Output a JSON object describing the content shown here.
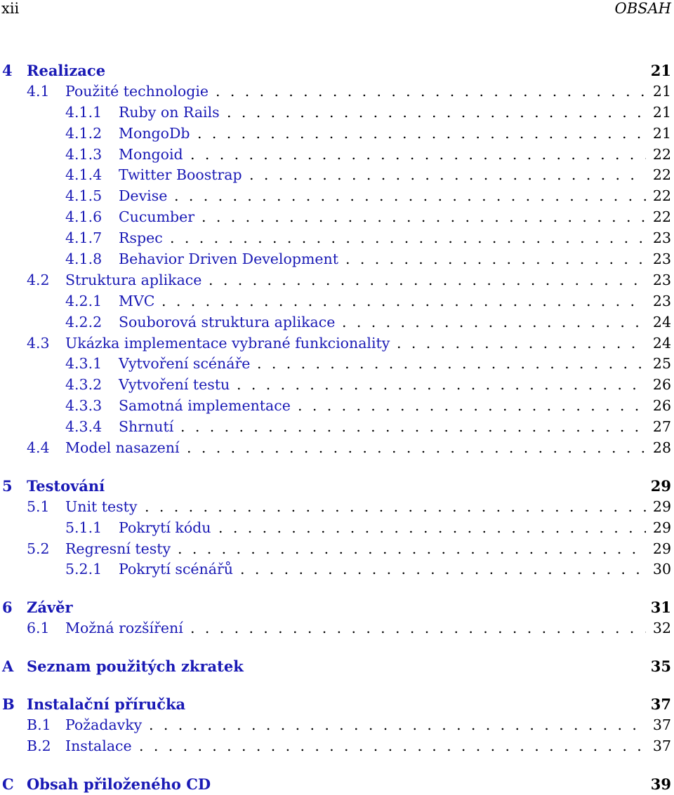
{
  "header": {
    "page_number": "xii",
    "title": "OBSAH"
  },
  "toc": [
    {
      "level": "chapter",
      "num": "4",
      "title": "Realizace",
      "page": "21",
      "gap": false
    },
    {
      "level": "section",
      "num": "4.1",
      "title": "Použité technologie",
      "page": "21"
    },
    {
      "level": "subsection",
      "num": "4.1.1",
      "title": "Ruby on Rails",
      "page": "21"
    },
    {
      "level": "subsection",
      "num": "4.1.2",
      "title": "MongoDb",
      "page": "21"
    },
    {
      "level": "subsection",
      "num": "4.1.3",
      "title": "Mongoid",
      "page": "22"
    },
    {
      "level": "subsection",
      "num": "4.1.4",
      "title": "Twitter Boostrap",
      "page": "22"
    },
    {
      "level": "subsection",
      "num": "4.1.5",
      "title": "Devise",
      "page": "22"
    },
    {
      "level": "subsection",
      "num": "4.1.6",
      "title": "Cucumber",
      "page": "22"
    },
    {
      "level": "subsection",
      "num": "4.1.7",
      "title": "Rspec",
      "page": "23"
    },
    {
      "level": "subsection",
      "num": "4.1.8",
      "title": "Behavior Driven Development",
      "page": "23"
    },
    {
      "level": "section",
      "num": "4.2",
      "title": "Struktura aplikace",
      "page": "23"
    },
    {
      "level": "subsection",
      "num": "4.2.1",
      "title": "MVC",
      "page": "23"
    },
    {
      "level": "subsection",
      "num": "4.2.2",
      "title": "Souborová struktura aplikace",
      "page": "24"
    },
    {
      "level": "section",
      "num": "4.3",
      "title": "Ukázka implementace vybrané funkcionality",
      "page": "24"
    },
    {
      "level": "subsection",
      "num": "4.3.1",
      "title": "Vytvoření scénáře",
      "page": "25"
    },
    {
      "level": "subsection",
      "num": "4.3.2",
      "title": "Vytvoření testu",
      "page": "26"
    },
    {
      "level": "subsection",
      "num": "4.3.3",
      "title": "Samotná implementace",
      "page": "26"
    },
    {
      "level": "subsection",
      "num": "4.3.4",
      "title": "Shrnutí",
      "page": "27"
    },
    {
      "level": "section",
      "num": "4.4",
      "title": "Model nasazení",
      "page": "28"
    },
    {
      "level": "chapter",
      "num": "5",
      "title": "Testování",
      "page": "29",
      "gap": true
    },
    {
      "level": "section",
      "num": "5.1",
      "title": "Unit testy",
      "page": "29"
    },
    {
      "level": "subsection",
      "num": "5.1.1",
      "title": "Pokrytí kódu",
      "page": "29"
    },
    {
      "level": "section",
      "num": "5.2",
      "title": "Regresní testy",
      "page": "29"
    },
    {
      "level": "subsection",
      "num": "5.2.1",
      "title": "Pokrytí scénářů",
      "page": "30"
    },
    {
      "level": "chapter",
      "num": "6",
      "title": "Závěr",
      "page": "31",
      "gap": true
    },
    {
      "level": "section",
      "num": "6.1",
      "title": "Možná rozšíření",
      "page": "32"
    },
    {
      "level": "chapter",
      "num": "A",
      "title": "Seznam použitých zkratek",
      "page": "35",
      "gap": true
    },
    {
      "level": "chapter",
      "num": "B",
      "title": "Instalační příručka",
      "page": "37",
      "gap": true
    },
    {
      "level": "section",
      "num": "B.1",
      "title": "Požadavky",
      "page": "37"
    },
    {
      "level": "section",
      "num": "B.2",
      "title": "Instalace",
      "page": "37"
    },
    {
      "level": "chapter",
      "num": "C",
      "title": "Obsah přiloženého CD",
      "page": "39",
      "gap": true
    }
  ],
  "colors": {
    "link": "#1a1ab5",
    "text": "#000000"
  }
}
